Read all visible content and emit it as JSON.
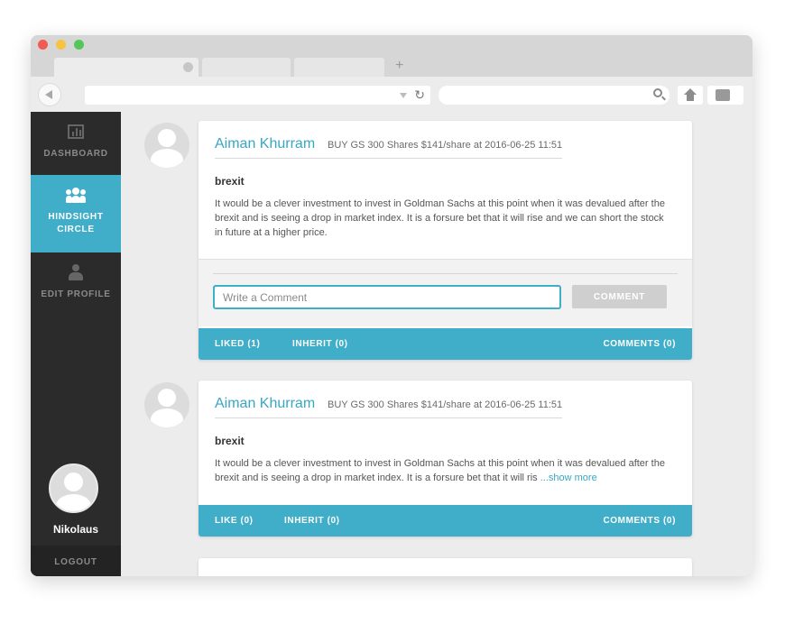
{
  "browser": {
    "tabs": [
      "",
      "",
      ""
    ],
    "new_tab_icon": "+",
    "url": "",
    "search_value": ""
  },
  "sidebar": {
    "items": [
      {
        "label": "DASHBOARD",
        "icon": "dashboard-icon"
      },
      {
        "label": "HINDSIGHT CIRCLE",
        "icon": "people-icon",
        "active": true
      },
      {
        "label": "EDIT PROFILE",
        "icon": "user-icon"
      }
    ],
    "username": "Nikolaus",
    "logout_label": "LOGOUT"
  },
  "posts": [
    {
      "author": "Aiman Khurram",
      "trade": "BUY GS 300 Shares $141/share at 2016-06-25 11:51",
      "title": "brexit",
      "body": "It would be a clever investment to invest in Goldman Sachs at this point when it was devalued after the brexit and is seeing a drop in market index. It is a forsure bet that it will rise and we can short the stock in future at a higher price.",
      "comment_placeholder": "Write a Comment",
      "comment_button": "COMMENT",
      "like_label": "LIKED (1)",
      "inherit_label": "INHERIT (0)",
      "comments_label": "COMMENTS (0)"
    },
    {
      "author": "Aiman Khurram",
      "trade": "BUY GS 300 Shares $141/share at 2016-06-25 11:51",
      "title": "brexit",
      "body": "It would be a clever investment to invest in Goldman Sachs at this point when it was devalued after the brexit and is seeing a drop in market index. It is a forsure bet that it will ris ",
      "show_more": "...show more",
      "like_label": "LIKE (0)",
      "inherit_label": "INHERIT (0)",
      "comments_label": "COMMENTS (0)"
    }
  ],
  "colors": {
    "accent": "#40aec8",
    "sidebar_bg": "#2b2b2b",
    "page_bg": "#ececec"
  }
}
